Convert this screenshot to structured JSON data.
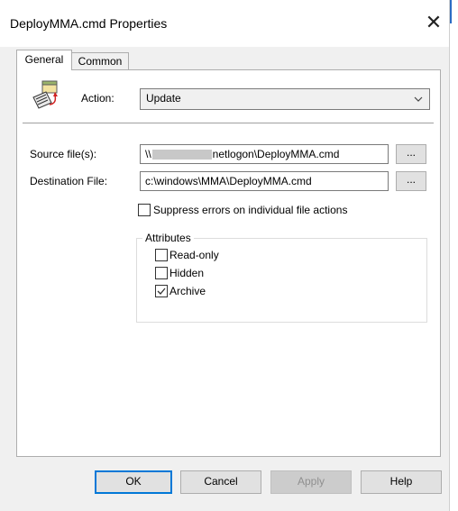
{
  "window": {
    "title": "DeployMMA.cmd Properties",
    "close_symbol": "✕"
  },
  "tabs": [
    {
      "label": "General",
      "active": true
    },
    {
      "label": "Common",
      "active": false
    }
  ],
  "general": {
    "action_label": "Action:",
    "action_value": "Update",
    "source_label": "Source file(s):",
    "source_prefix": "\\\\",
    "source_suffix": "netlogon\\DeployMMA.cmd",
    "destination_label": "Destination File:",
    "destination_value": "c:\\windows\\MMA\\DeployMMA.cmd",
    "browse_label": "...",
    "suppress_label": "Suppress errors on individual file actions",
    "suppress_checked": false,
    "attributes_title": "Attributes",
    "attributes": [
      {
        "label": "Read-only",
        "checked": false
      },
      {
        "label": "Hidden",
        "checked": false
      },
      {
        "label": "Archive",
        "checked": true
      }
    ]
  },
  "buttons": {
    "ok": "OK",
    "cancel": "Cancel",
    "apply": "Apply",
    "help": "Help"
  },
  "icons": {
    "action": "file-update-icon",
    "dropdown": "chevron-down-icon",
    "close": "close-icon",
    "check": "checkmark-icon"
  }
}
